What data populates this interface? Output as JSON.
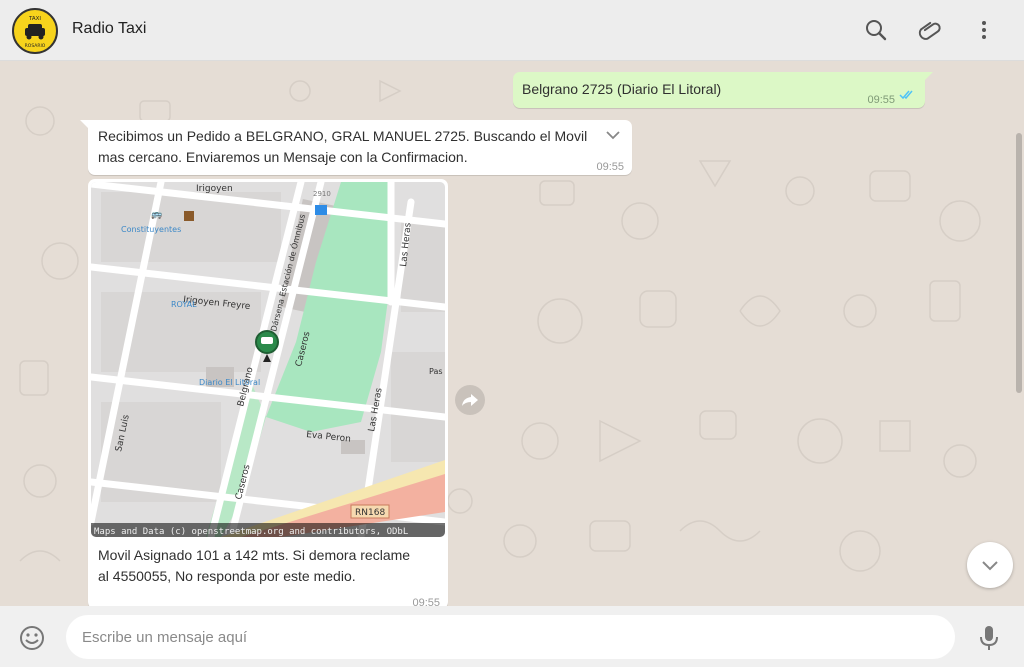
{
  "header": {
    "contact_name": "Radio Taxi",
    "avatar_text_top": "TAXI",
    "avatar_text_bottom": "ROSARIO",
    "icons": [
      "search-icon",
      "attach-icon",
      "menu-icon"
    ]
  },
  "messages": [
    {
      "direction": "outgoing",
      "text": "Belgrano 2725 (Diario El Litoral)",
      "time": "09:55",
      "status": "read"
    },
    {
      "direction": "incoming",
      "text_line1": "Recibimos un Pedido a BELGRANO, GRAL MANUEL 2725. Buscando el Movil",
      "text_line2": "mas cercano. Enviaremos un Mensaje con la Confirmacion.",
      "time": "09:55"
    },
    {
      "direction": "incoming",
      "type": "location",
      "map": {
        "streets": [
          "Irigoyen",
          "Irigoyen Freyre",
          "Belgrano",
          "Dársena Estación de Ómnibus",
          "Caseros",
          "Las Heras",
          "Eva Peron",
          "San Luis",
          "Pas",
          "RN168"
        ],
        "places": [
          "Constituyentes",
          "ROYAL",
          "Diario El Litoral"
        ],
        "marks": [
          "2910"
        ],
        "attribution": "Maps and Data (c) openstreetmap.org and contributors, ODbL"
      },
      "text_line1": "Movil Asignado 101 a 142 mts. Si demora reclame",
      "text_line2": "al 4550055, No responda por este medio.",
      "time": "09:55"
    }
  ],
  "composer": {
    "placeholder": "Escribe un mensaje aquí"
  },
  "colors": {
    "outgoing_bubble": "#dcf8c6",
    "incoming_bubble": "#ffffff",
    "chat_background": "#e5ddd5",
    "read_ticks": "#4fc3f7"
  }
}
